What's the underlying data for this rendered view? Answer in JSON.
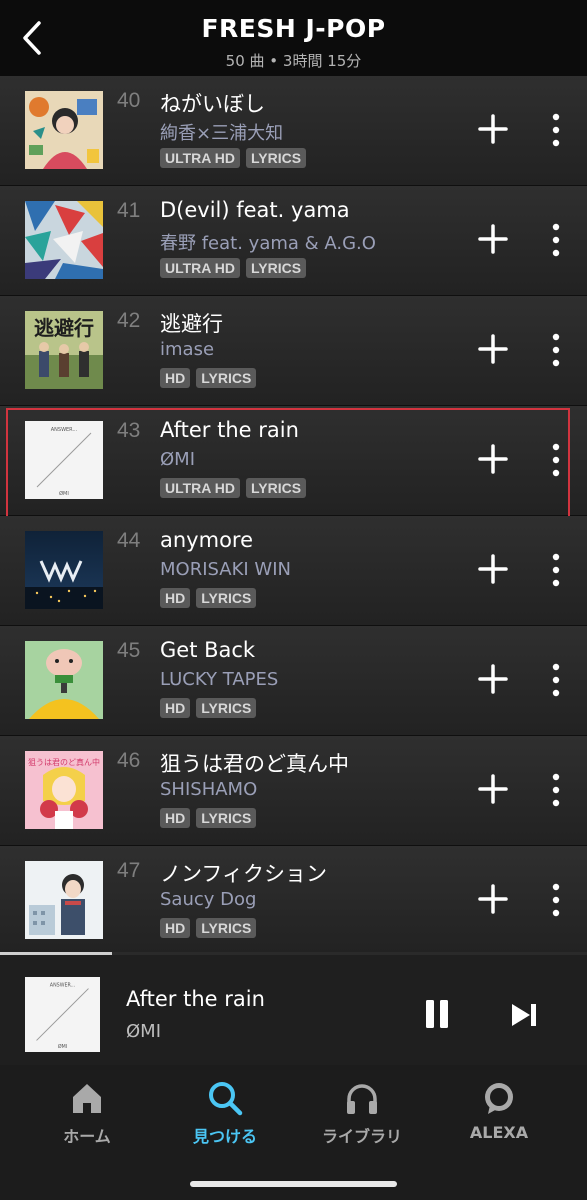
{
  "header": {
    "title": "FRESH J-POP",
    "subtitle": "50 曲 • 3時間 15分"
  },
  "tracks": [
    {
      "number": "40",
      "title": "ねがいぼし",
      "artist": "絢香×三浦大知",
      "badges": [
        "ULTRA HD",
        "LYRICS"
      ]
    },
    {
      "number": "41",
      "title": "D(evil) feat. yama",
      "artist": "春野 feat. yama & A.G.O",
      "badges": [
        "ULTRA HD",
        "LYRICS"
      ]
    },
    {
      "number": "42",
      "title": "逃避行",
      "artist": "imase",
      "badges": [
        "HD",
        "LYRICS"
      ]
    },
    {
      "number": "43",
      "title": "After the rain",
      "artist": "ØMI",
      "badges": [
        "ULTRA HD",
        "LYRICS"
      ]
    },
    {
      "number": "44",
      "title": "anymore",
      "artist": "MORISAKI WIN",
      "badges": [
        "HD",
        "LYRICS"
      ]
    },
    {
      "number": "45",
      "title": "Get Back",
      "artist": "LUCKY TAPES",
      "badges": [
        "HD",
        "LYRICS"
      ]
    },
    {
      "number": "46",
      "title": "狙うは君のど真ん中",
      "artist": "SHISHAMO",
      "badges": [
        "HD",
        "LYRICS"
      ]
    },
    {
      "number": "47",
      "title": "ノンフィクション",
      "artist": "Saucy Dog",
      "badges": [
        "HD",
        "LYRICS"
      ]
    }
  ],
  "art": {
    "album_42_text": "逃避行",
    "album_43_text": "ANSWER...",
    "album_43_artist": "ØMI",
    "album_46_text": "狙うは君のど真ん中"
  },
  "now_playing": {
    "title": "After the rain",
    "artist": "ØMI",
    "progress_fraction": 0.19
  },
  "nav": [
    {
      "label": "ホーム",
      "icon": "home-icon"
    },
    {
      "label": "見つける",
      "icon": "search-icon"
    },
    {
      "label": "ライブラリ",
      "icon": "headphones-icon"
    },
    {
      "label": "ALEXA",
      "icon": "alexa-icon"
    }
  ],
  "colors": {
    "accent": "#4bc6f4",
    "selection_border": "#d2343f",
    "artist_text": "#9a9fb7",
    "badge_bg": "#5a5a5a"
  }
}
